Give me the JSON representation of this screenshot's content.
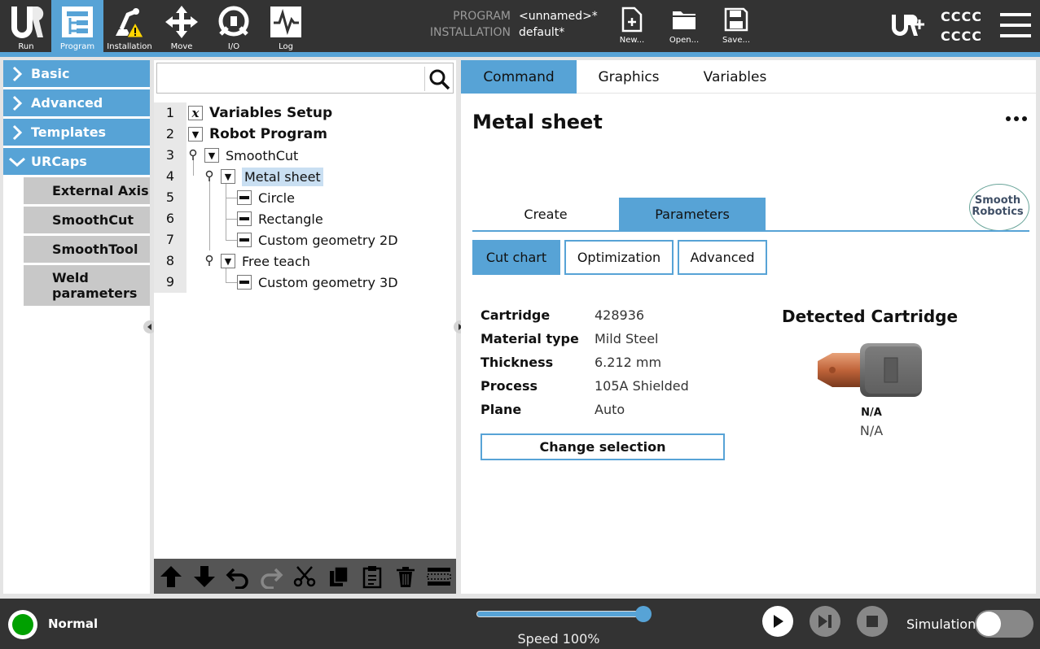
{
  "topbar": {
    "nav": [
      {
        "label": "Run",
        "icon": "ur-logo-icon"
      },
      {
        "label": "Program",
        "icon": "program-icon",
        "active": true
      },
      {
        "label": "Installation",
        "icon": "installation-icon"
      },
      {
        "label": "Move",
        "icon": "move-icon"
      },
      {
        "label": "I/O",
        "icon": "io-icon"
      },
      {
        "label": "Log",
        "icon": "log-icon"
      }
    ],
    "program_key": "PROGRAM",
    "program_value": "<unnamed>*",
    "installation_key": "INSTALLATION",
    "installation_value": "default*",
    "file_buttons": [
      {
        "label": "New...",
        "icon": "new-file-icon"
      },
      {
        "label": "Open...",
        "icon": "open-folder-icon"
      },
      {
        "label": "Save...",
        "icon": "save-icon"
      }
    ],
    "user_line1": "CCCC",
    "user_line2": "CCCC",
    "accent": "#57a3d6"
  },
  "sidebar": {
    "categories": [
      {
        "label": "Basic",
        "expanded": false
      },
      {
        "label": "Advanced",
        "expanded": false
      },
      {
        "label": "Templates",
        "expanded": false
      },
      {
        "label": "URCaps",
        "expanded": true
      }
    ],
    "urcaps": [
      "External Axis",
      "SmoothCut",
      "SmoothTool",
      "Weld parameters"
    ]
  },
  "tree": {
    "search_placeholder": "",
    "line_numbers": [
      "1",
      "2",
      "3",
      "4",
      "5",
      "6",
      "7",
      "8",
      "9"
    ],
    "nodes": [
      {
        "label": "Variables Setup",
        "icon": "variable-x-icon"
      },
      {
        "label": "Robot Program",
        "icon": "expand-triangle-icon"
      },
      {
        "label": "SmoothCut",
        "icon": "expand-triangle-icon"
      },
      {
        "label": "Metal sheet",
        "icon": "expand-triangle-icon",
        "selected": true
      },
      {
        "label": "Circle",
        "icon": "command-dash-icon"
      },
      {
        "label": "Rectangle",
        "icon": "command-dash-icon"
      },
      {
        "label": "Custom geometry 2D",
        "icon": "command-dash-icon"
      },
      {
        "label": "Free teach",
        "icon": "expand-triangle-icon"
      },
      {
        "label": "Custom geometry 3D",
        "icon": "command-dash-icon"
      }
    ]
  },
  "main": {
    "tabs": [
      "Command",
      "Graphics",
      "Variables"
    ],
    "node_title": "Metal sheet",
    "subtabs": [
      "Create",
      "Parameters"
    ],
    "logo_line1": "Smooth",
    "logo_line2": "Robotics",
    "cut_tabs": [
      "Cut chart",
      "Optimization",
      "Advanced"
    ],
    "properties": [
      {
        "key": "Cartridge",
        "value": "428936"
      },
      {
        "key": "Material type",
        "value": "Mild Steel"
      },
      {
        "key": "Thickness",
        "value": "6.212 mm"
      },
      {
        "key": "Process",
        "value": "105A Shielded"
      },
      {
        "key": "Plane",
        "value": "Auto"
      }
    ],
    "change_button": "Change selection",
    "detected_title": "Detected Cartridge",
    "cartridge_name": "N/A",
    "cartridge_desc": "N/A"
  },
  "bottombar": {
    "status": "Normal",
    "status_color": "#00a000",
    "speed_label": "Speed 100%",
    "speed_fraction": 1.0,
    "simulation_label": "Simulation",
    "simulation_on": false
  }
}
